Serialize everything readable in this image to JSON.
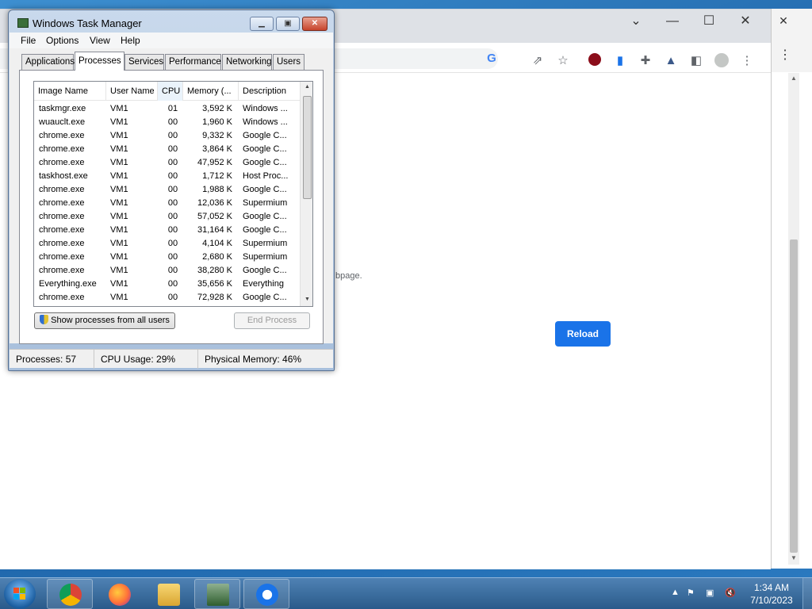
{
  "desktop": {
    "chrome": {
      "page_text": "bpage.",
      "reload_label": "Reload",
      "toolbar_icons": [
        "google-icon",
        "share-icon",
        "star-icon",
        "extension-red-icon",
        "extension-book-icon",
        "puzzle-icon",
        "flask-icon",
        "sidepanel-icon",
        "profile-icon",
        "kebab-menu-icon"
      ]
    }
  },
  "task_manager": {
    "title": "Windows Task Manager",
    "menu": [
      "File",
      "Options",
      "View",
      "Help"
    ],
    "tabs": [
      "Applications",
      "Processes",
      "Services",
      "Performance",
      "Networking",
      "Users"
    ],
    "active_tab": "Processes",
    "columns": [
      "Image Name",
      "User Name",
      "CPU",
      "Memory (...",
      "Description"
    ],
    "rows": [
      {
        "name": "taskmgr.exe",
        "user": "VM1",
        "cpu": "01",
        "mem": "3,592 K",
        "desc": "Windows ..."
      },
      {
        "name": "wuauclt.exe",
        "user": "VM1",
        "cpu": "00",
        "mem": "1,960 K",
        "desc": "Windows ..."
      },
      {
        "name": "chrome.exe",
        "user": "VM1",
        "cpu": "00",
        "mem": "9,332 K",
        "desc": "Google C..."
      },
      {
        "name": "chrome.exe",
        "user": "VM1",
        "cpu": "00",
        "mem": "3,864 K",
        "desc": "Google C..."
      },
      {
        "name": "chrome.exe",
        "user": "VM1",
        "cpu": "00",
        "mem": "47,952 K",
        "desc": "Google C..."
      },
      {
        "name": "taskhost.exe",
        "user": "VM1",
        "cpu": "00",
        "mem": "1,712 K",
        "desc": "Host Proc..."
      },
      {
        "name": "chrome.exe",
        "user": "VM1",
        "cpu": "00",
        "mem": "1,988 K",
        "desc": "Google C..."
      },
      {
        "name": "chrome.exe",
        "user": "VM1",
        "cpu": "00",
        "mem": "12,036 K",
        "desc": "Supermium"
      },
      {
        "name": "chrome.exe",
        "user": "VM1",
        "cpu": "00",
        "mem": "57,052 K",
        "desc": "Google C..."
      },
      {
        "name": "chrome.exe",
        "user": "VM1",
        "cpu": "00",
        "mem": "31,164 K",
        "desc": "Google C..."
      },
      {
        "name": "chrome.exe",
        "user": "VM1",
        "cpu": "00",
        "mem": "4,104 K",
        "desc": "Supermium"
      },
      {
        "name": "chrome.exe",
        "user": "VM1",
        "cpu": "00",
        "mem": "2,680 K",
        "desc": "Supermium"
      },
      {
        "name": "chrome.exe",
        "user": "VM1",
        "cpu": "00",
        "mem": "38,280 K",
        "desc": "Google C..."
      },
      {
        "name": "Everything.exe",
        "user": "VM1",
        "cpu": "00",
        "mem": "35,656 K",
        "desc": "Everything"
      },
      {
        "name": "chrome.exe",
        "user": "VM1",
        "cpu": "00",
        "mem": "72,928 K",
        "desc": "Google C..."
      }
    ],
    "show_all_label": "Show processes from all users",
    "end_process_label": "End Process",
    "status": {
      "processes": "Processes: 57",
      "cpu": "CPU Usage: 29%",
      "memory": "Physical Memory: 46%"
    }
  },
  "taskbar": {
    "apps": [
      "chrome-icon",
      "firefox-icon",
      "explorer-icon",
      "task-manager-icon",
      "supermium-icon"
    ],
    "clock_time": "1:34 AM",
    "clock_date": "7/10/2023"
  }
}
